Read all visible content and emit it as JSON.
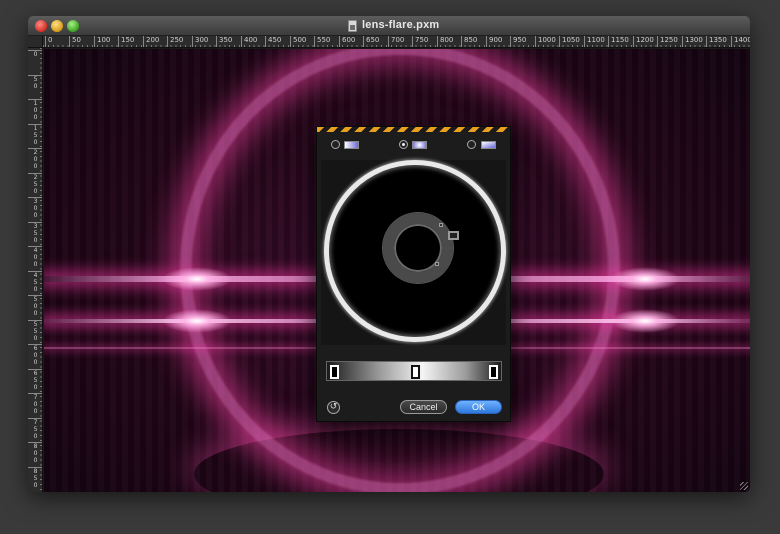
{
  "window": {
    "title": "lens-flare.pxm",
    "doc_icon": "document-icon"
  },
  "ruler": {
    "horizontal": [
      "0",
      "50",
      "100",
      "150",
      "200",
      "250",
      "300",
      "350",
      "400",
      "450",
      "500",
      "550",
      "600",
      "650",
      "700",
      "750",
      "800",
      "850",
      "900",
      "950",
      "1000",
      "1050",
      "1100",
      "1150",
      "1200",
      "1250",
      "1300",
      "1350",
      "1400"
    ],
    "vertical": [
      "0",
      "50",
      "100",
      "150",
      "200",
      "250",
      "300",
      "350",
      "400",
      "450",
      "500",
      "550",
      "600",
      "650",
      "700",
      "750",
      "800",
      "850"
    ]
  },
  "canvas": {
    "colors": {
      "glow": "#ff5ab4",
      "background": "#1c0515"
    }
  },
  "gradient_dialog": {
    "modes": [
      {
        "icon": "linear-gradient-swatch",
        "selected": false
      },
      {
        "icon": "radial-gradient-swatch",
        "selected": true
      },
      {
        "icon": "angle-gradient-swatch",
        "selected": false
      }
    ],
    "reset_icon": "↺",
    "cancel_label": "Cancel",
    "ok_label": "OK",
    "colors": {
      "accent": "#3a86ee",
      "hazard": "#e8a020"
    }
  }
}
